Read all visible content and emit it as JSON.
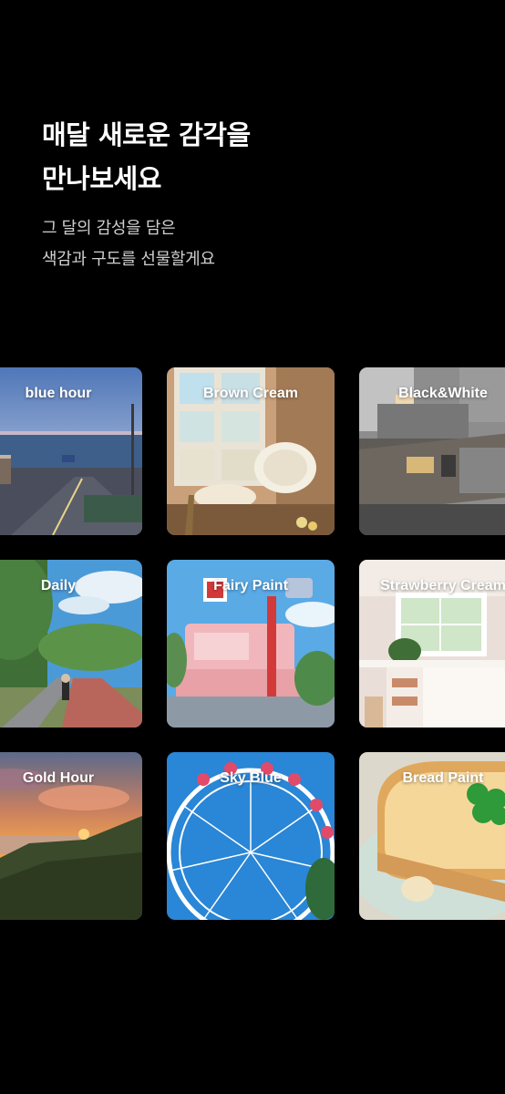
{
  "headline": {
    "line1": "매달 새로운 감각을",
    "line2": "만나보세요"
  },
  "subtitle": {
    "line1": "그 달의 감성을 담은",
    "line2": "색감과 구도를 선물할게요"
  },
  "filters": [
    {
      "label": "blue hour"
    },
    {
      "label": "Brown Cream"
    },
    {
      "label": "Black&White"
    },
    {
      "label": "Daily"
    },
    {
      "label": "Fairy Paint"
    },
    {
      "label": "Strawberry Cream"
    },
    {
      "label": "Gold Hour"
    },
    {
      "label": "Sky Blue"
    },
    {
      "label": "Bread Paint"
    }
  ]
}
